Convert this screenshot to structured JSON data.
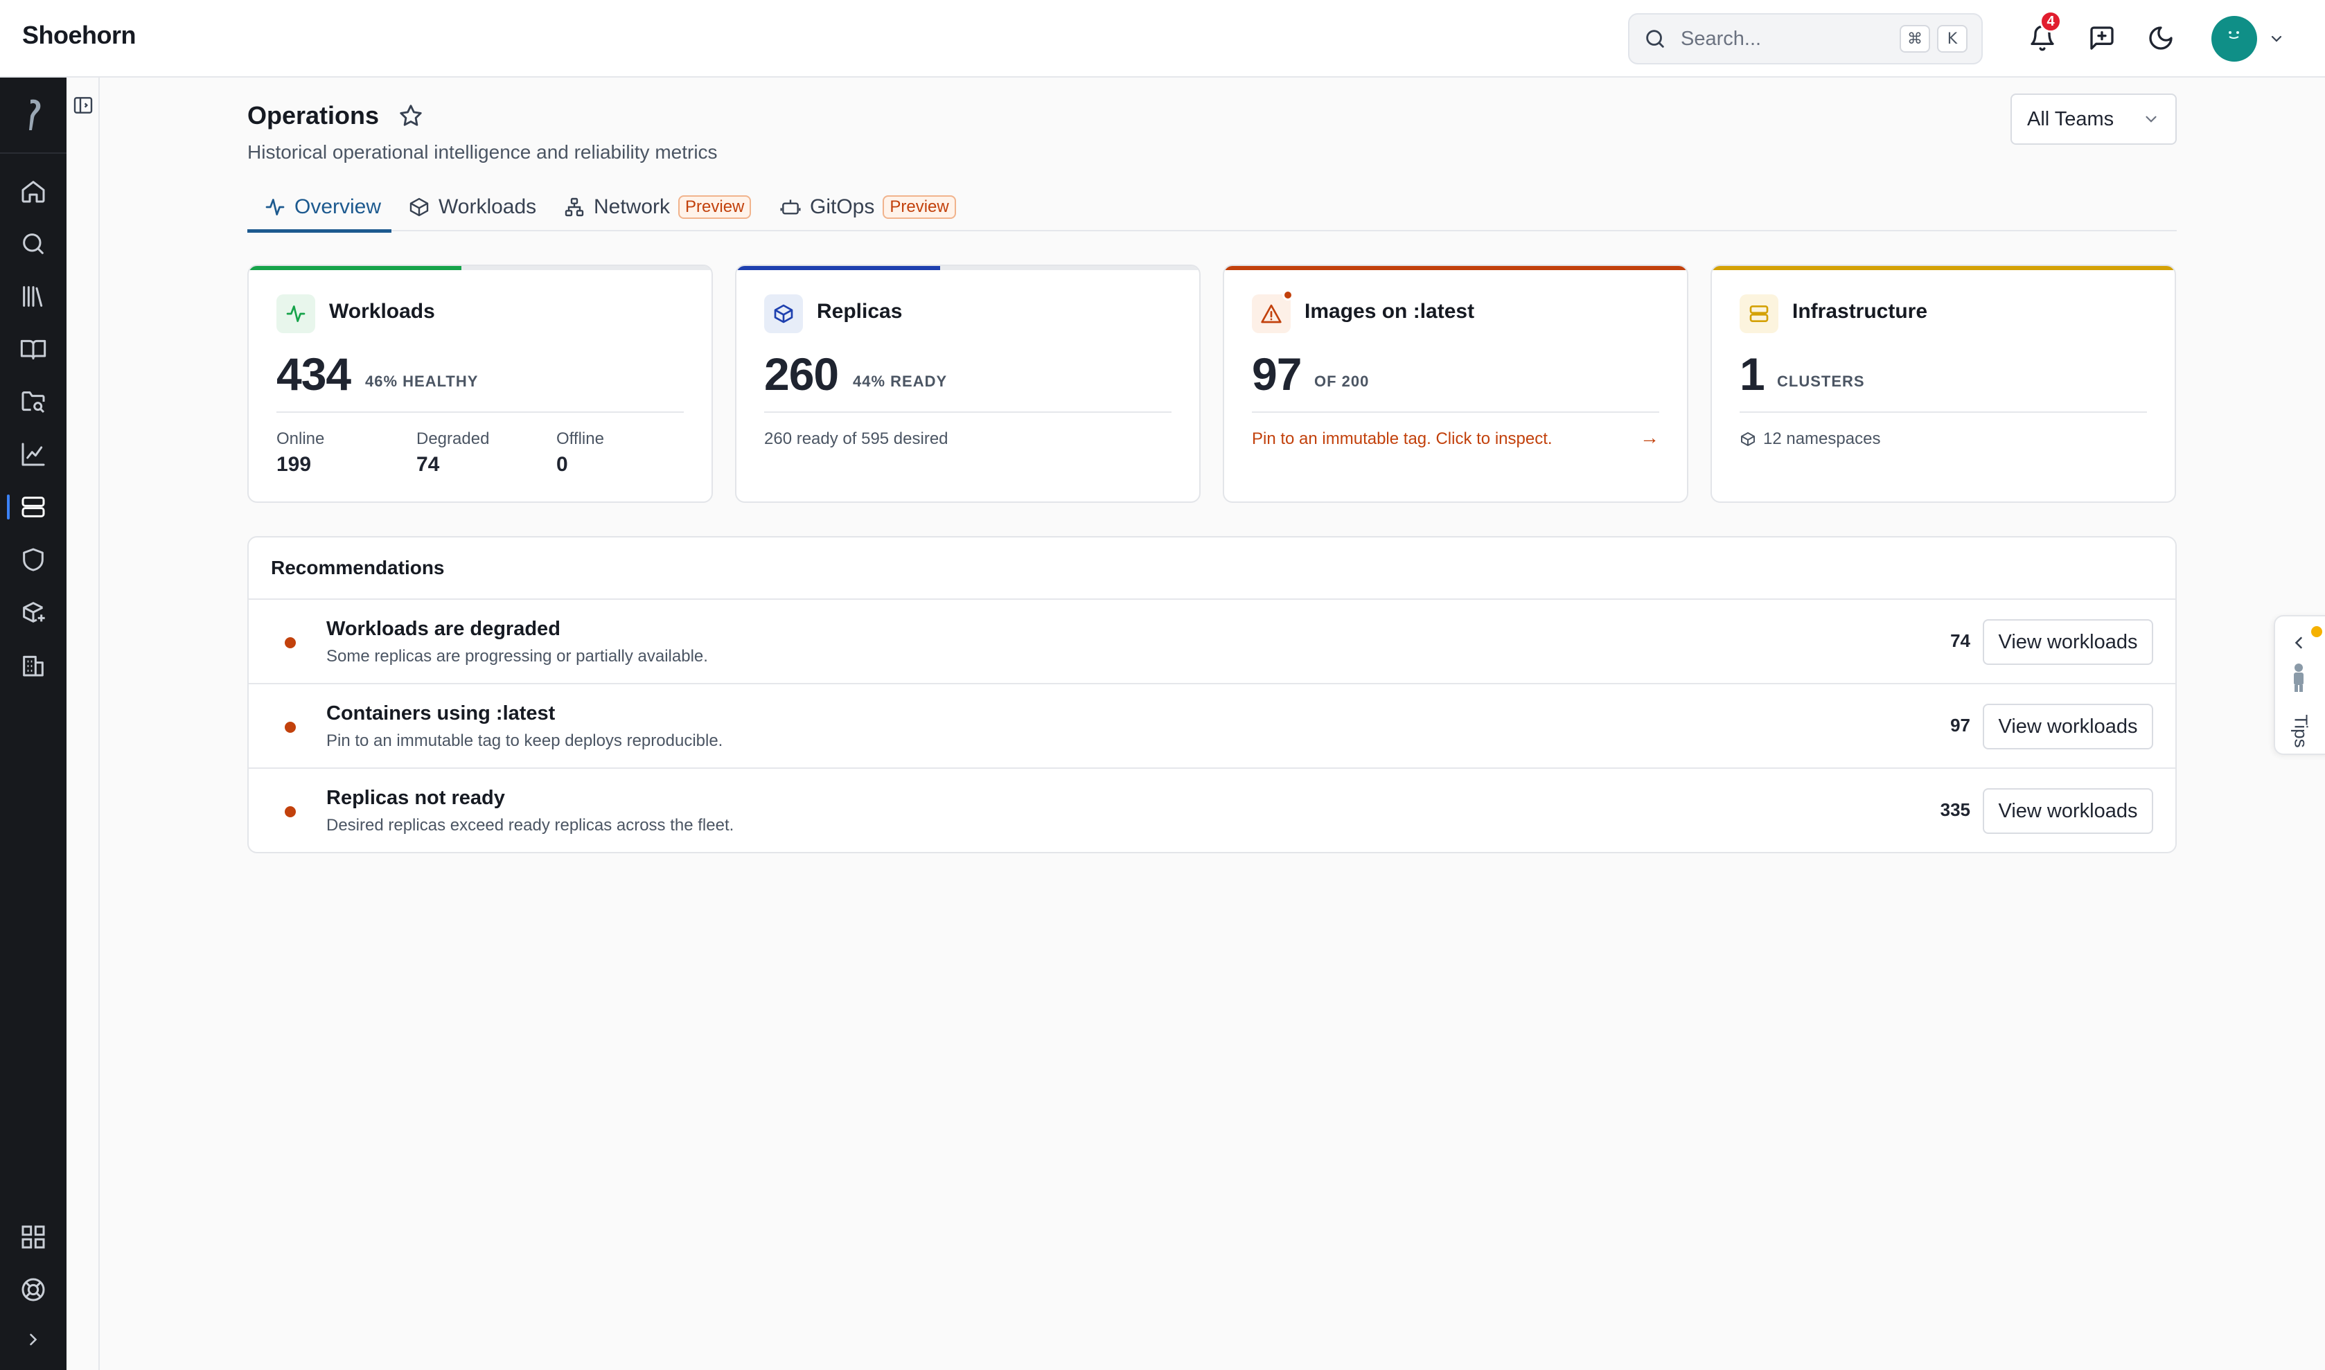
{
  "app": {
    "name": "Shoehorn"
  },
  "header": {
    "search_placeholder": "Search...",
    "shortcut_keys": [
      "⌘",
      "K"
    ],
    "notification_count": "4"
  },
  "page": {
    "title": "Operations",
    "subtitle": "Historical operational intelligence and reliability metrics",
    "team_filter": "All Teams"
  },
  "tabs": [
    {
      "label": "Overview",
      "active": true
    },
    {
      "label": "Workloads",
      "active": false
    },
    {
      "label": "Network",
      "badge": "Preview",
      "active": false
    },
    {
      "label": "GitOps",
      "badge": "Preview",
      "active": false
    }
  ],
  "cards": {
    "workloads": {
      "title": "Workloads",
      "value": "434",
      "unit": "46% HEALTHY",
      "progress": 0.46,
      "accent": "#16a34a",
      "stats": [
        {
          "label": "Online",
          "value": "199"
        },
        {
          "label": "Degraded",
          "value": "74"
        },
        {
          "label": "Offline",
          "value": "0"
        }
      ]
    },
    "replicas": {
      "title": "Replicas",
      "value": "260",
      "unit": "44% READY",
      "progress": 0.44,
      "accent": "#1e40af",
      "footer": "260 ready of 595 desired"
    },
    "images": {
      "title": "Images on :latest",
      "value": "97",
      "unit": "OF 200",
      "progress": 1.0,
      "accent": "#c2410c",
      "warning": "Pin to an immutable tag. Click to inspect.",
      "arrow": "→"
    },
    "infrastructure": {
      "title": "Infrastructure",
      "value": "1",
      "unit": "CLUSTERS",
      "progress": 1.0,
      "accent": "#d4a106",
      "footer": "12 namespaces"
    }
  },
  "recommendations": {
    "title": "Recommendations",
    "items": [
      {
        "title": "Workloads are degraded",
        "description": "Some replicas are progressing or partially available.",
        "count": "74",
        "action": "View workloads"
      },
      {
        "title": "Containers using :latest",
        "description": "Pin to an immutable tag to keep deploys reproducible.",
        "count": "97",
        "action": "View workloads"
      },
      {
        "title": "Replicas not ready",
        "description": "Desired replicas exceed ready replicas across the fleet.",
        "count": "335",
        "action": "View workloads"
      }
    ]
  },
  "tips": {
    "label": "Tips"
  },
  "icons": {
    "rail": [
      "home-icon",
      "search-icon",
      "library-icon",
      "book-open-icon",
      "folder-search-icon",
      "chart-line-icon",
      "server-icon",
      "shield-icon",
      "package-plus-icon",
      "building-icon"
    ],
    "rail_bottom": [
      "apps-grid-icon",
      "help-buoy-icon",
      "chevron-right-icon"
    ]
  }
}
